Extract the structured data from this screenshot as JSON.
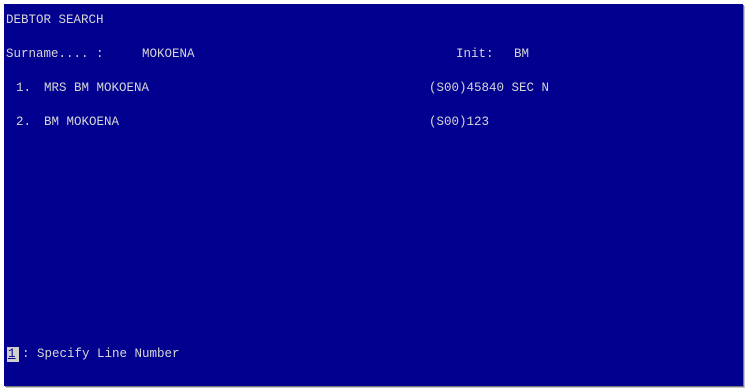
{
  "screen": {
    "title": "DEBTOR SEARCH",
    "surname_label": "Surname.... :",
    "surname_value": "MOKOENA",
    "initials_label": "Init:",
    "initials_value": "BM"
  },
  "results": [
    {
      "number": "1.",
      "name": "MRS BM MOKOENA",
      "reference": "(S00)45840 SEC N"
    },
    {
      "number": "2.",
      "name": "BM MOKOENA",
      "reference": "(S00)123"
    }
  ],
  "prompt": {
    "input_value": "1",
    "label": ": Specify Line Number"
  },
  "colors": {
    "background": "#02018f",
    "text": "#d6d6d6",
    "input_highlight": "#cfcfcf"
  }
}
